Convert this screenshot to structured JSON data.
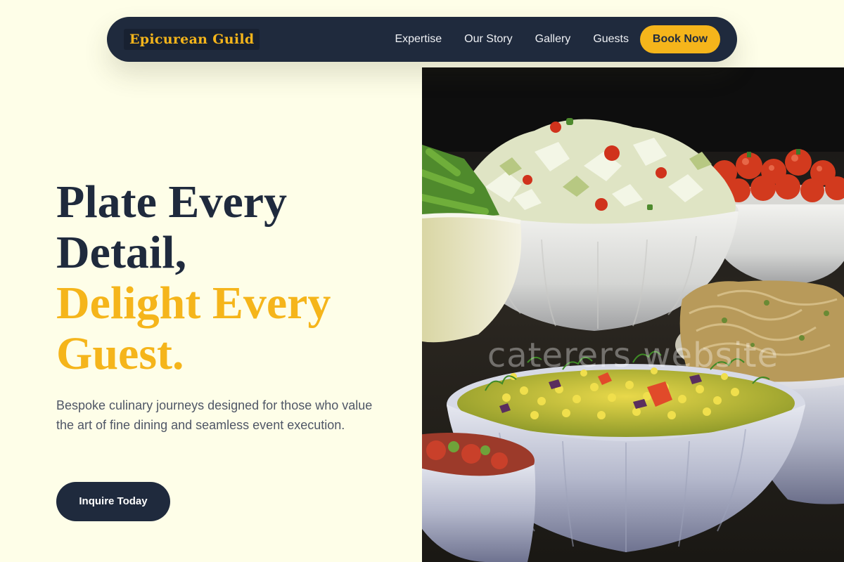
{
  "nav": {
    "brand": "Epicurean Guild",
    "links": [
      "Expertise",
      "Our Story",
      "Gallery",
      "Guests"
    ],
    "cta": "Book Now"
  },
  "hero": {
    "title_line1": "Plate Every",
    "title_line2": "Detail,",
    "title_accent_line1": "Delight Every",
    "title_accent_line2": "Guest.",
    "description": "Bespoke culinary journeys designed for those who value the art of fine dining and seamless event execution.",
    "cta": "Inquire Today",
    "image_watermark": "caterers website"
  },
  "colors": {
    "background": "#fefee8",
    "navy": "#1f2a3d",
    "accent": "#f5b51b",
    "body_text": "#4f5666"
  }
}
